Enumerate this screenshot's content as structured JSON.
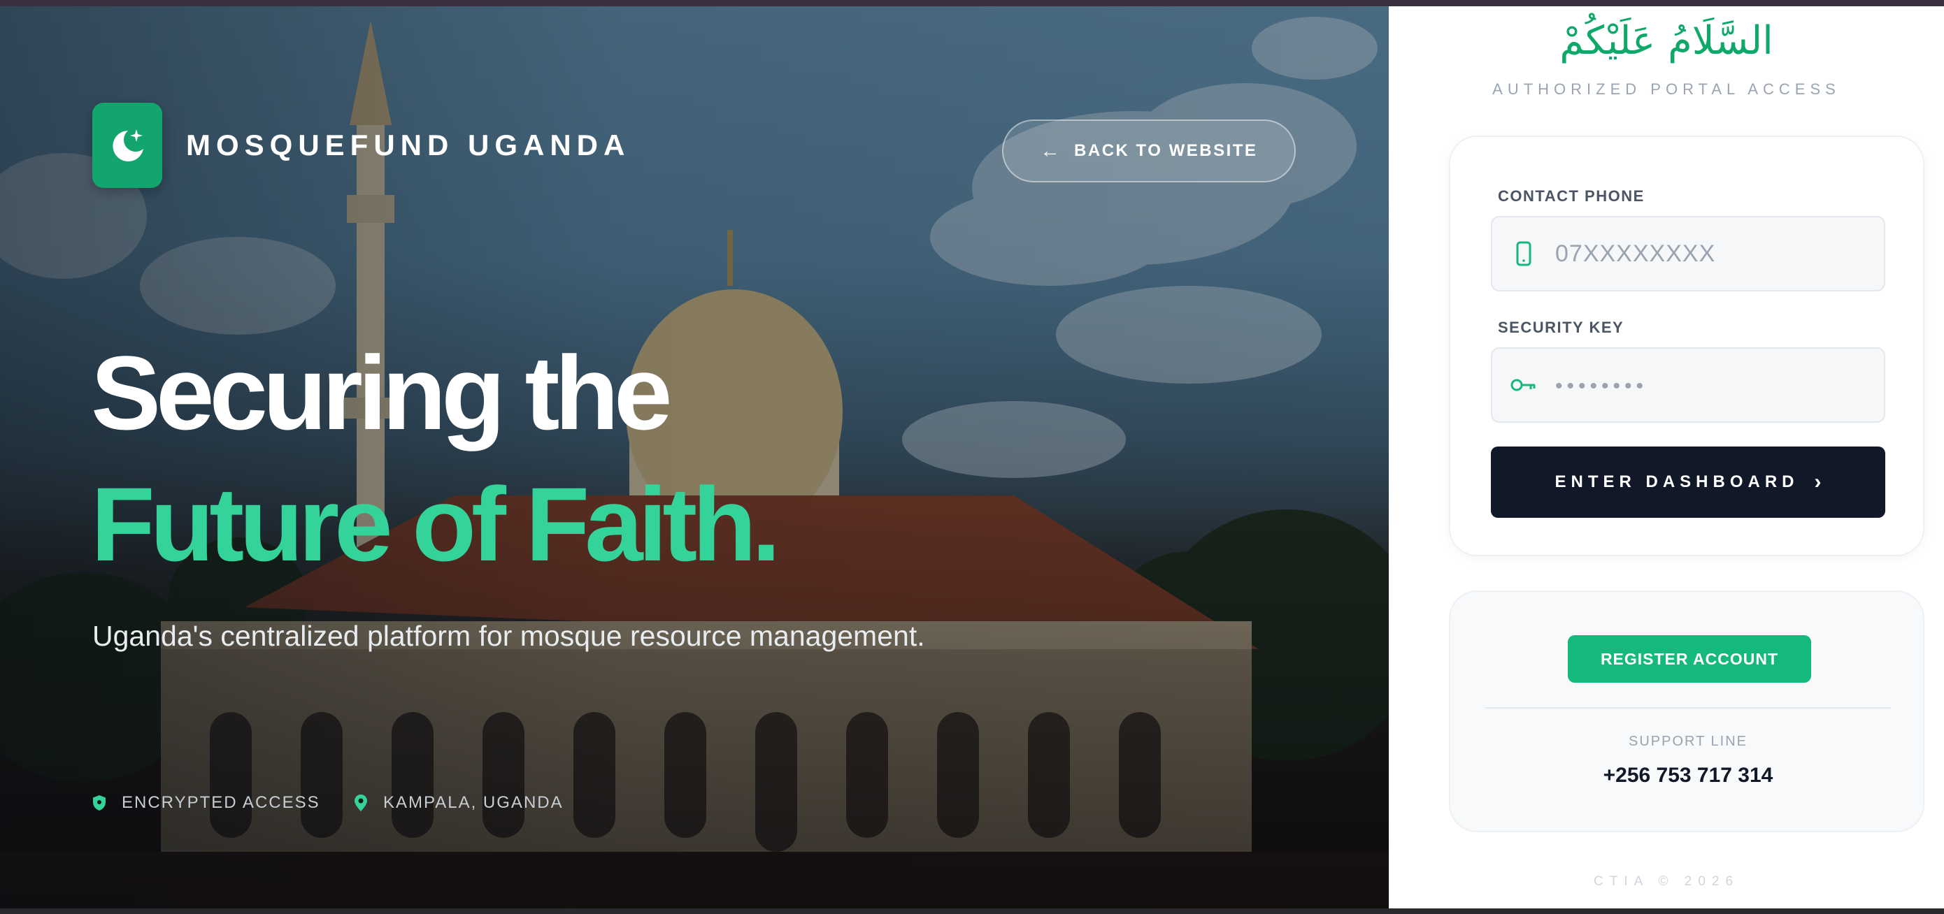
{
  "brand": {
    "name": "MOSQUEFUND UGANDA",
    "accent_color": "#12a56e"
  },
  "nav": {
    "back_label": "BACK TO WEBSITE",
    "back_icon": "arrow-left-icon"
  },
  "hero": {
    "headline_line1": "Securing the",
    "headline_line2": "Future of Faith.",
    "headline_accent_color": "#34d399",
    "tagline": "Uganda's centralized platform for mosque resource management.",
    "meta": [
      {
        "icon": "shield-icon",
        "label": "ENCRYPTED ACCESS"
      },
      {
        "icon": "map-pin-icon",
        "label": "KAMPALA, UGANDA"
      }
    ]
  },
  "login": {
    "greeting_arabic": "السَّلَامُ عَلَيْكُمْ",
    "subtitle": "AUTHORIZED PORTAL ACCESS",
    "phone": {
      "label": "CONTACT PHONE",
      "placeholder": "07XXXXXXXX",
      "value": "",
      "icon": "phone-icon"
    },
    "key": {
      "label": "SECURITY KEY",
      "placeholder": "••••••••",
      "value": "",
      "icon": "key-icon"
    },
    "submit_label": "ENTER DASHBOARD",
    "submit_icon": "chevron-right-icon",
    "submit_color": "#111827"
  },
  "register": {
    "button_label": "REGISTER ACCOUNT",
    "button_color": "#16b97c",
    "support_label": "SUPPORT LINE",
    "support_phone": "+256 753 717 314"
  },
  "footer": {
    "text": "CTIA © 2026"
  }
}
